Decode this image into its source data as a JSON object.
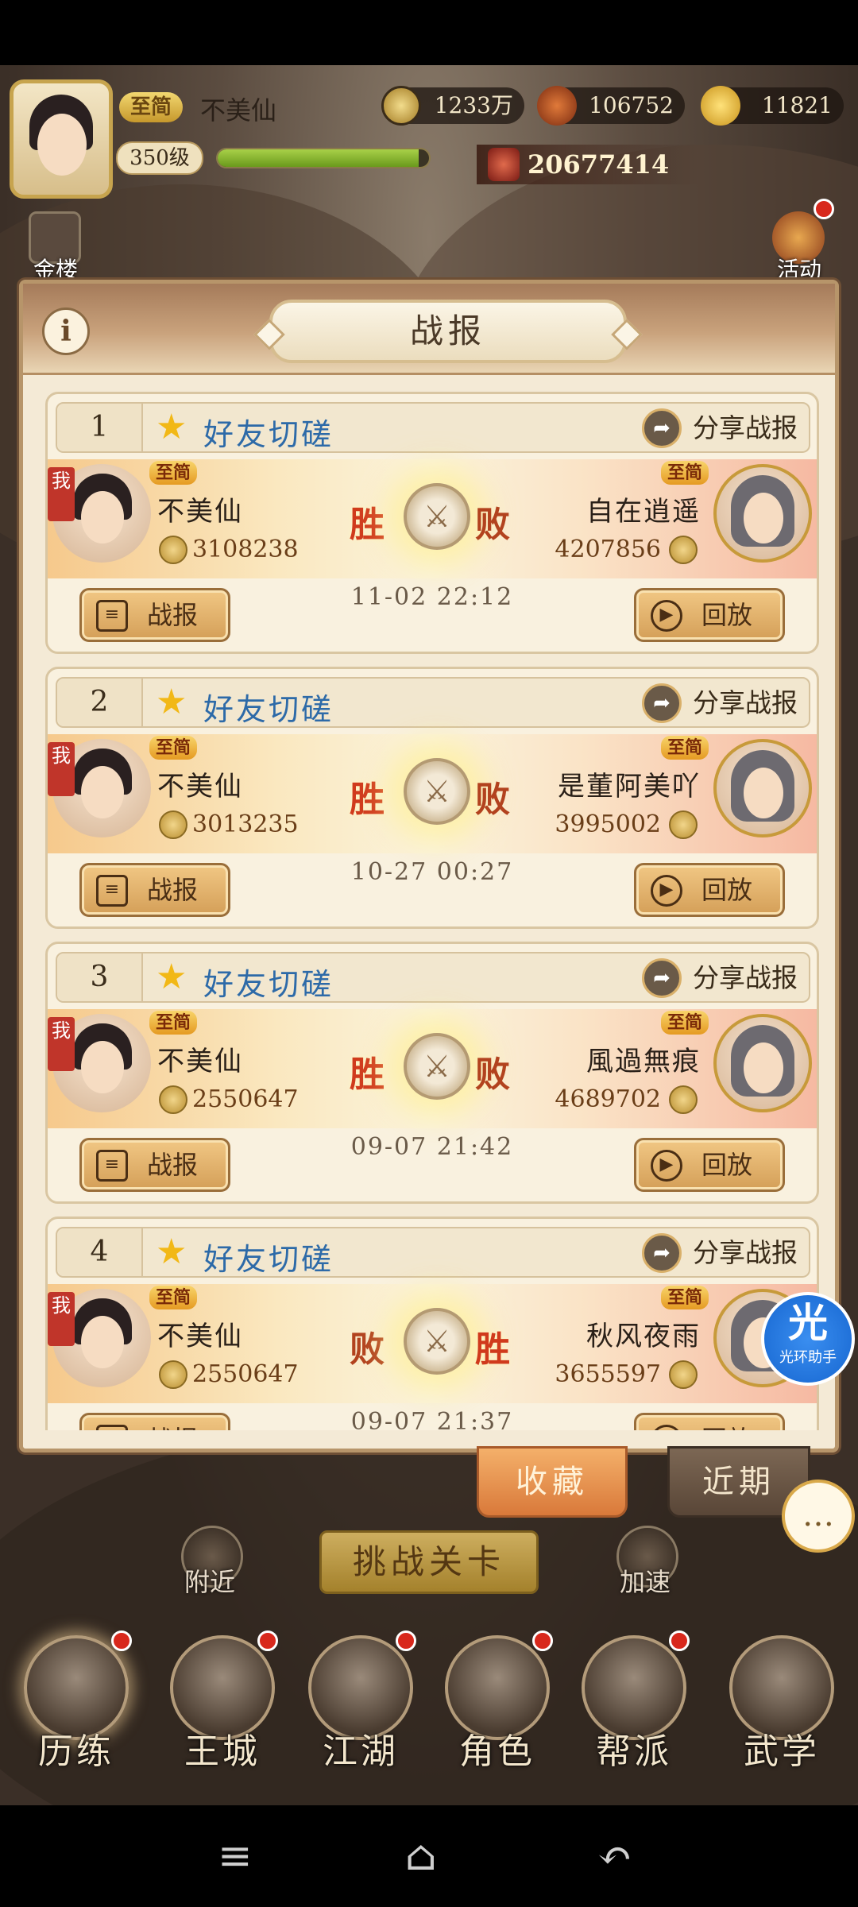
{
  "player": {
    "vip": "至简",
    "name": "不美仙",
    "level": "350级",
    "xp_fraction": 0.95,
    "power": "20677414"
  },
  "resources": [
    {
      "icon": "coin-icon",
      "value": "1233万"
    },
    {
      "icon": "gem-icon",
      "value": "106752"
    },
    {
      "icon": "gold-ingot-icon",
      "value": "11821"
    }
  ],
  "side_buttons": {
    "left": "金楼",
    "right": "活动"
  },
  "modal": {
    "title": "战报",
    "info_icon": "i"
  },
  "reports": [
    {
      "index": "1",
      "mode": "好友切磋",
      "share": "分享战报",
      "me": {
        "vip": "至简",
        "name": "不美仙",
        "score": "3108238",
        "tag": "我",
        "result": "胜"
      },
      "opponent": {
        "vip": "至简",
        "name": "自在逍遥",
        "score": "4207856",
        "result": "败"
      },
      "time": "11-02 22:12",
      "report_btn": "战报",
      "replay_btn": "回放"
    },
    {
      "index": "2",
      "mode": "好友切磋",
      "share": "分享战报",
      "me": {
        "vip": "至简",
        "name": "不美仙",
        "score": "3013235",
        "tag": "我",
        "result": "胜"
      },
      "opponent": {
        "vip": "至简",
        "name": "是董阿美吖",
        "score": "3995002",
        "result": "败"
      },
      "time": "10-27 00:27",
      "report_btn": "战报",
      "replay_btn": "回放"
    },
    {
      "index": "3",
      "mode": "好友切磋",
      "share": "分享战报",
      "me": {
        "vip": "至简",
        "name": "不美仙",
        "score": "2550647",
        "tag": "我",
        "result": "胜"
      },
      "opponent": {
        "vip": "至简",
        "name": "風過無痕",
        "score": "4689702",
        "result": "败"
      },
      "time": "09-07 21:42",
      "report_btn": "战报",
      "replay_btn": "回放"
    },
    {
      "index": "4",
      "mode": "好友切磋",
      "share": "分享战报",
      "me": {
        "vip": "至简",
        "name": "不美仙",
        "score": "2550647",
        "tag": "我",
        "result": "败"
      },
      "opponent": {
        "vip": "至简",
        "name": "秋风夜雨",
        "score": "3655597",
        "result": "胜"
      },
      "time": "09-07 21:37",
      "report_btn": "战报",
      "replay_btn": "回放"
    }
  ],
  "tabs": {
    "favorites": "收藏",
    "recent": "近期"
  },
  "bottom": {
    "challenge": "挑战关卡",
    "nearby": "附近",
    "speedup": "加速"
  },
  "nav": [
    {
      "label": "历练",
      "icon": "training-icon",
      "dot": true
    },
    {
      "label": "王城",
      "icon": "palace-icon",
      "dot": true
    },
    {
      "label": "江湖",
      "icon": "jianghu-icon",
      "dot": true
    },
    {
      "label": "角色",
      "icon": "character-icon",
      "dot": true
    },
    {
      "label": "帮派",
      "icon": "guild-icon",
      "dot": true
    },
    {
      "label": "武学",
      "icon": "martial-arts-icon",
      "dot": false
    }
  ],
  "assistant_badge": {
    "glyph": "光",
    "label": "光环助手"
  },
  "colors": {
    "win": "#d03a1c",
    "mode": "#2d6aa8",
    "vip": "#e59a22",
    "modal_bg": "#f4ead6"
  }
}
